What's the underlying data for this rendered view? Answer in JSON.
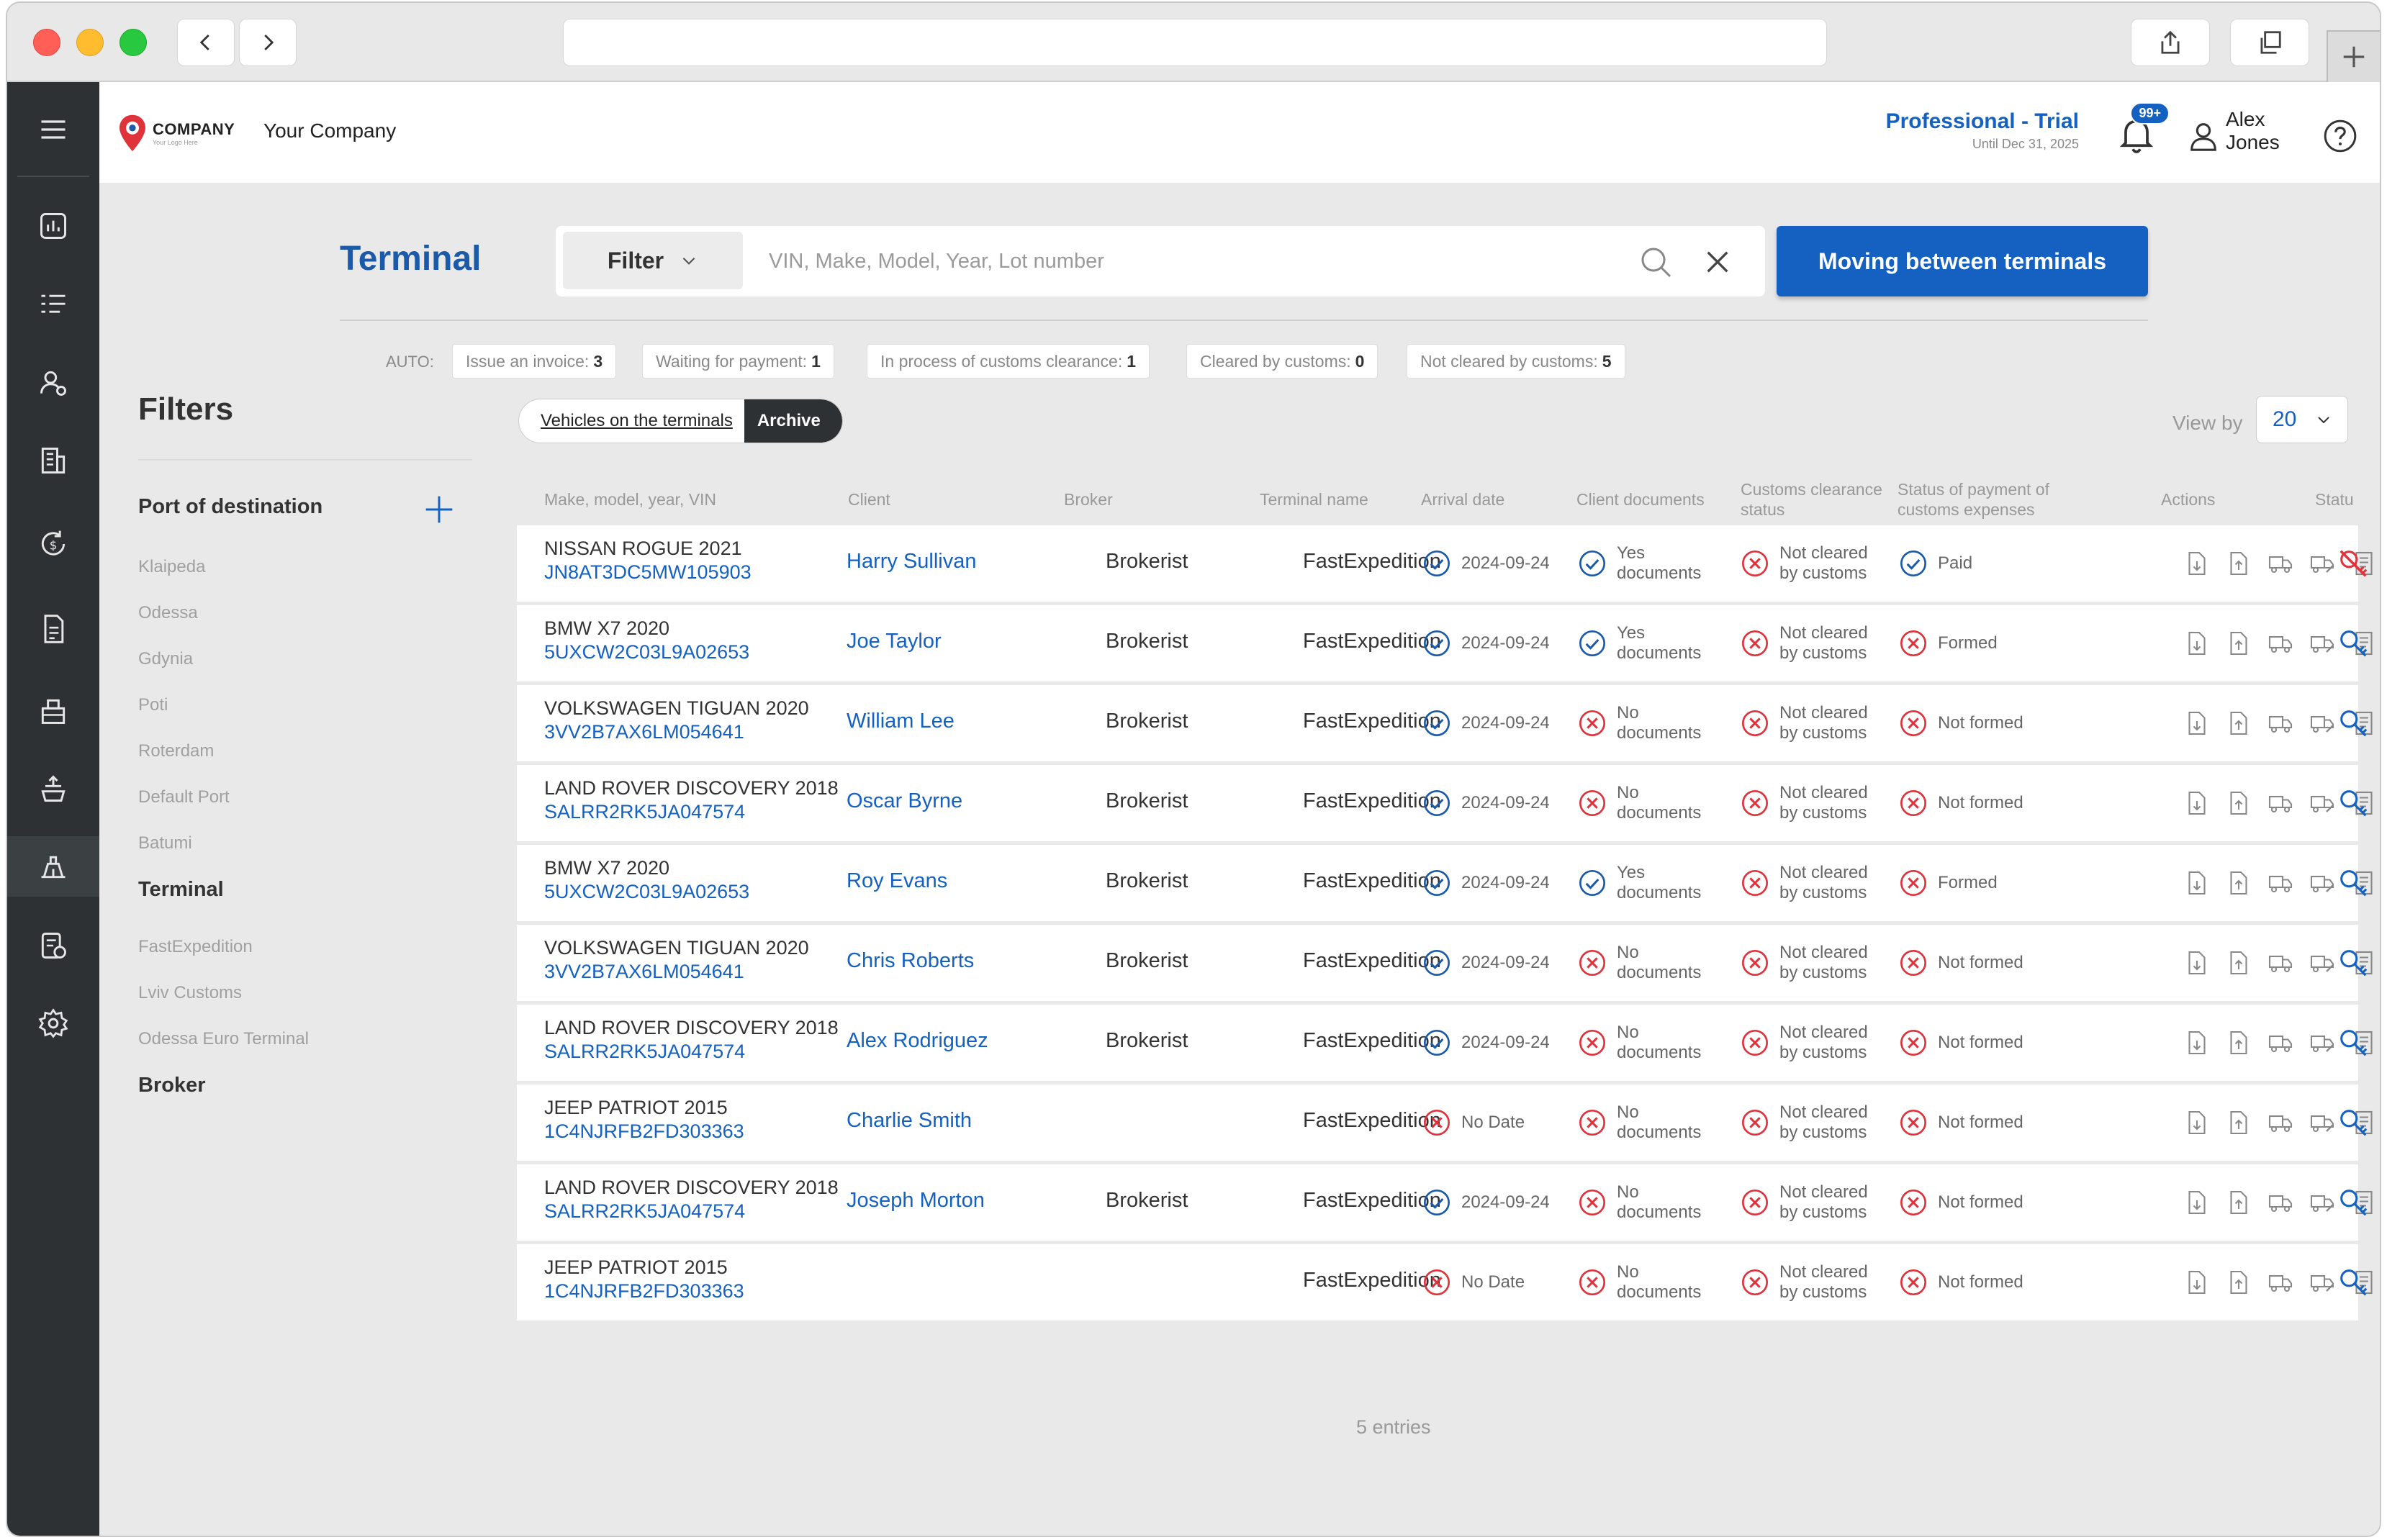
{
  "header": {
    "logo_text": "COMPANY",
    "logo_tagline": "Your Logo Here",
    "company_name": "Your Company",
    "plan_name": "Professional - Trial",
    "plan_until": "Until Dec 31, 2025",
    "notifications_badge": "99+",
    "user_name": "Alex Jones"
  },
  "page": {
    "title": "Terminal",
    "filter_label": "Filter",
    "search_placeholder": "VIN, Make, Model, Year, Lot number",
    "move_button": "Moving between terminals"
  },
  "auto": {
    "label": "AUTO:",
    "chips": [
      {
        "label": "Issue an invoice:",
        "count": "3"
      },
      {
        "label": "Waiting for payment:",
        "count": "1"
      },
      {
        "label": "In process of customs clearance:",
        "count": "1"
      },
      {
        "label": "Cleared by customs:",
        "count": "0"
      },
      {
        "label": "Not cleared by customs:",
        "count": "5"
      }
    ]
  },
  "filters": {
    "title": "Filters",
    "port_group": "Port of destination",
    "ports": [
      "Klaipeda",
      "Odessa",
      "Gdynia",
      "Poti",
      "Roterdam",
      "Default Port",
      "Batumi"
    ],
    "terminal_group": "Terminal",
    "terminals": [
      "FastExpedition",
      "Lviv Customs",
      "Odessa Euro Terminal"
    ],
    "broker_group": "Broker"
  },
  "toggle": {
    "vehicles": "Vehicles on the terminals",
    "archive": "Archive"
  },
  "view_by": {
    "label": "View by",
    "value": "20"
  },
  "table": {
    "headers": {
      "make": "Make, model, year, VIN",
      "client": "Client",
      "broker": "Broker",
      "terminal": "Terminal name",
      "arrival": "Arrival date",
      "docs": "Client documents",
      "customs": "Customs clearance status",
      "payment": "Status of payment of customs expenses",
      "actions": "Actions",
      "status": "Statu"
    },
    "rows": [
      {
        "make": "NISSAN ROGUE 2021",
        "vin": "JN8AT3DC5MW105903",
        "client": "Harry Sullivan",
        "broker": "Brokerist",
        "terminal": "FastExpedition",
        "arrival": "2024-09-24",
        "arrival_ok": true,
        "docs": "Yes documents",
        "docs_ok": true,
        "customs": "Not cleared by customs",
        "payment": "Paid",
        "payment_ok": true,
        "status_icon": "red"
      },
      {
        "make": "BMW X7 2020",
        "vin": "5UXCW2C03L9A02653",
        "client": "Joe Taylor",
        "broker": "Brokerist",
        "terminal": "FastExpedition",
        "arrival": "2024-09-24",
        "arrival_ok": true,
        "docs": "Yes documents",
        "docs_ok": true,
        "customs": "Not cleared by customs",
        "payment": "Formed",
        "payment_ok": false,
        "status_icon": "blue"
      },
      {
        "make": "VOLKSWAGEN TIGUAN 2020",
        "vin": "3VV2B7AX6LM054641",
        "client": "William Lee",
        "broker": "Brokerist",
        "terminal": "FastExpedition",
        "arrival": "2024-09-24",
        "arrival_ok": true,
        "docs": "No documents",
        "docs_ok": false,
        "customs": "Not cleared by customs",
        "payment": "Not formed",
        "payment_ok": false,
        "status_icon": "blue"
      },
      {
        "make": "LAND ROVER DISCOVERY 2018",
        "vin": "SALRR2RK5JA047574",
        "client": "Oscar Byrne",
        "broker": "Brokerist",
        "terminal": "FastExpedition",
        "arrival": "2024-09-24",
        "arrival_ok": true,
        "docs": "No documents",
        "docs_ok": false,
        "customs": "Not cleared by customs",
        "payment": "Not formed",
        "payment_ok": false,
        "status_icon": "blue"
      },
      {
        "make": "BMW X7 2020",
        "vin": "5UXCW2C03L9A02653",
        "client": "Roy Evans",
        "broker": "Brokerist",
        "terminal": "FastExpedition",
        "arrival": "2024-09-24",
        "arrival_ok": true,
        "docs": "Yes documents",
        "docs_ok": true,
        "customs": "Not cleared by customs",
        "payment": "Formed",
        "payment_ok": false,
        "status_icon": "blue"
      },
      {
        "make": "VOLKSWAGEN TIGUAN 2020",
        "vin": "3VV2B7AX6LM054641",
        "client": "Chris Roberts",
        "broker": "Brokerist",
        "terminal": "FastExpedition",
        "arrival": "2024-09-24",
        "arrival_ok": true,
        "docs": "No documents",
        "docs_ok": false,
        "customs": "Not cleared by customs",
        "payment": "Not formed",
        "payment_ok": false,
        "status_icon": "blue"
      },
      {
        "make": "LAND ROVER DISCOVERY 2018",
        "vin": "SALRR2RK5JA047574",
        "client": "Alex Rodriguez",
        "broker": "Brokerist",
        "terminal": "FastExpedition",
        "arrival": "2024-09-24",
        "arrival_ok": true,
        "docs": "No documents",
        "docs_ok": false,
        "customs": "Not cleared by customs",
        "payment": "Not formed",
        "payment_ok": false,
        "status_icon": "blue"
      },
      {
        "make": "JEEP PATRIOT 2015",
        "vin": "1C4NJRFB2FD303363",
        "client": "Charlie Smith",
        "broker": "",
        "terminal": "FastExpedition",
        "arrival": "No Date",
        "arrival_ok": false,
        "docs": "No documents",
        "docs_ok": false,
        "customs": "Not cleared by customs",
        "payment": "Not formed",
        "payment_ok": false,
        "status_icon": "blue"
      },
      {
        "make": "LAND ROVER DISCOVERY 2018",
        "vin": "SALRR2RK5JA047574",
        "client": "Joseph Morton",
        "broker": "Brokerist",
        "terminal": "FastExpedition",
        "arrival": "2024-09-24",
        "arrival_ok": true,
        "docs": "No documents",
        "docs_ok": false,
        "customs": "Not cleared by customs",
        "payment": "Not formed",
        "payment_ok": false,
        "status_icon": "blue"
      },
      {
        "make": "JEEP PATRIOT 2015",
        "vin": "1C4NJRFB2FD303363",
        "client": "",
        "broker": "",
        "terminal": "FastExpedition",
        "arrival": "No Date",
        "arrival_ok": false,
        "docs": "No documents",
        "docs_ok": false,
        "customs": "Not cleared by customs",
        "payment": "Not formed",
        "payment_ok": false,
        "status_icon": "blue"
      }
    ],
    "entries": "5 entries"
  },
  "colors": {
    "accent": "#1461c2",
    "ok": "#1b5aa8",
    "error": "#e0323a",
    "sidebar": "#2d3133"
  },
  "icons": {
    "sidebar": [
      "menu-icon",
      "dashboard-icon",
      "checklist-icon",
      "users-icon",
      "building-icon",
      "exchange-icon",
      "document-icon",
      "warehouse-icon",
      "port-crane-icon",
      "terminal-icon",
      "invoice-icon",
      "settings-icon"
    ],
    "row_actions": [
      "download-icon",
      "upload-icon",
      "truck-icon",
      "truck-edit-icon",
      "file-icon"
    ]
  }
}
